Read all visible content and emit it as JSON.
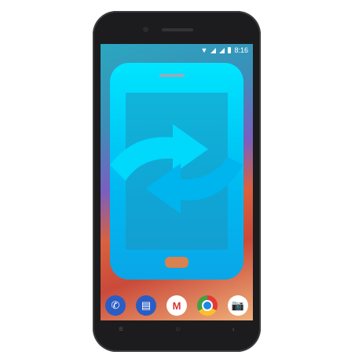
{
  "status_bar": {
    "time": "8:16"
  },
  "dock": [
    {
      "icon": "phone-icon",
      "color": "#2a5dc4"
    },
    {
      "icon": "messages-icon",
      "color": "#2a5dc4"
    },
    {
      "icon": "gmail-icon",
      "color": "#ffffff"
    },
    {
      "icon": "chrome-icon",
      "color": "#4caf50"
    },
    {
      "icon": "camera-icon",
      "color": "#ffffff"
    }
  ],
  "overlay": {
    "icon": "sync-phone-icon",
    "color": "#00c8f5"
  }
}
